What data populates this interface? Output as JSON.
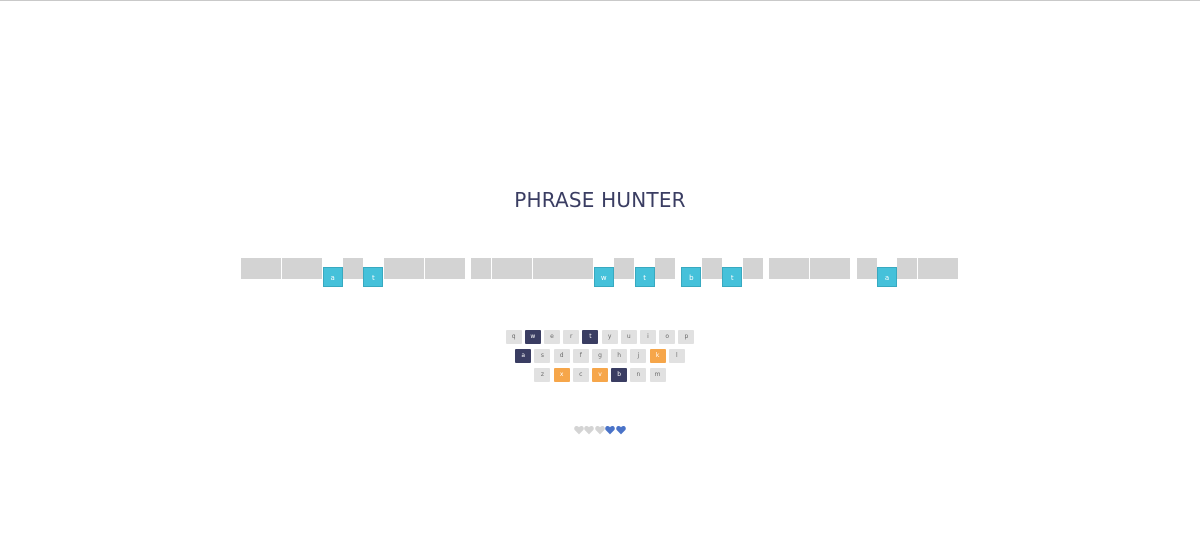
{
  "title": "PHRASE HUNTER",
  "phrase": {
    "letters": [
      {
        "char": "",
        "shown": false
      },
      {
        "char": "",
        "shown": false
      },
      {
        "char": "",
        "shown": false
      },
      {
        "char": "",
        "shown": false
      },
      {
        "char": "a",
        "shown": true
      },
      {
        "char": "",
        "shown": false
      },
      {
        "char": "t",
        "shown": true
      },
      {
        "char": "",
        "shown": false
      },
      {
        "char": "",
        "shown": false
      },
      {
        "char": "",
        "shown": false
      },
      {
        "char": "",
        "shown": false
      },
      {
        "char": " ",
        "space": true
      },
      {
        "char": "",
        "shown": false
      },
      {
        "char": "",
        "shown": false
      },
      {
        "char": "",
        "shown": false
      },
      {
        "char": "",
        "shown": false
      },
      {
        "char": "",
        "shown": false
      },
      {
        "char": "",
        "shown": false
      },
      {
        "char": "w",
        "shown": true
      },
      {
        "char": "",
        "shown": false
      },
      {
        "char": "t",
        "shown": true
      },
      {
        "char": "",
        "shown": false
      },
      {
        "char": " ",
        "space": true
      },
      {
        "char": "b",
        "shown": true
      },
      {
        "char": "",
        "shown": false
      },
      {
        "char": "t",
        "shown": true
      },
      {
        "char": "",
        "shown": false
      },
      {
        "char": " ",
        "space": true
      },
      {
        "char": "",
        "shown": false
      },
      {
        "char": "",
        "shown": false
      },
      {
        "char": "",
        "shown": false
      },
      {
        "char": "",
        "shown": false
      },
      {
        "char": " ",
        "space": true
      },
      {
        "char": "",
        "shown": false
      },
      {
        "char": "a",
        "shown": true
      },
      {
        "char": "",
        "shown": false
      },
      {
        "char": "",
        "shown": false
      },
      {
        "char": "",
        "shown": false
      }
    ]
  },
  "keyboard": {
    "rows": [
      [
        {
          "key": "q",
          "state": "unused"
        },
        {
          "key": "w",
          "state": "chosen"
        },
        {
          "key": "e",
          "state": "unused"
        },
        {
          "key": "r",
          "state": "unused"
        },
        {
          "key": "t",
          "state": "chosen"
        },
        {
          "key": "y",
          "state": "unused"
        },
        {
          "key": "u",
          "state": "unused"
        },
        {
          "key": "i",
          "state": "unused"
        },
        {
          "key": "o",
          "state": "unused"
        },
        {
          "key": "p",
          "state": "unused"
        }
      ],
      [
        {
          "key": "a",
          "state": "chosen"
        },
        {
          "key": "s",
          "state": "unused"
        },
        {
          "key": "d",
          "state": "unused"
        },
        {
          "key": "f",
          "state": "unused"
        },
        {
          "key": "g",
          "state": "unused"
        },
        {
          "key": "h",
          "state": "unused"
        },
        {
          "key": "j",
          "state": "unused"
        },
        {
          "key": "k",
          "state": "wrong"
        },
        {
          "key": "l",
          "state": "unused"
        }
      ],
      [
        {
          "key": "z",
          "state": "unused"
        },
        {
          "key": "x",
          "state": "wrong"
        },
        {
          "key": "c",
          "state": "unused"
        },
        {
          "key": "v",
          "state": "wrong"
        },
        {
          "key": "b",
          "state": "chosen"
        },
        {
          "key": "n",
          "state": "unused"
        },
        {
          "key": "m",
          "state": "unused"
        }
      ]
    ]
  },
  "lives": {
    "total": 5,
    "remaining": 2,
    "icon": "heart-icon",
    "lost_color": "#d4d4d4",
    "live_color": "#4a73c8"
  },
  "colors": {
    "title": "#3a3d62",
    "tile_hidden": "#d3d3d3",
    "tile_shown": "#45c1da",
    "key_default": "#e1e1e1",
    "key_chosen": "#3a3d62",
    "key_wrong": "#f6a64a"
  }
}
